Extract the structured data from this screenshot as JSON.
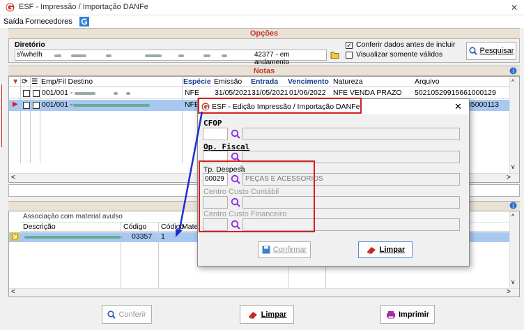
{
  "window": {
    "title": "ESF - Impressão / Importação DANFe",
    "close": "✕"
  },
  "menu": {
    "items": [
      "Saída",
      "Fornecedores"
    ]
  },
  "options": {
    "header": "Opções",
    "dir_label": "Diretório",
    "dir_value": "s\\\\whelh",
    "status_text": "42377 - em andamento",
    "check1": "Conferir dados antes de incluir",
    "check2": "Visualizar somente válidos",
    "search_button": "Pesquisar"
  },
  "notes": {
    "header": "Notas",
    "columns": [
      "Emp/Fil Destino",
      "Espécie",
      "Emissão",
      "Entrada",
      "Vencimento",
      "Natureza",
      "Arquivo"
    ],
    "rows": [
      {
        "emp": "001/001 -",
        "especie": "NFE",
        "emissao": "31/05/2021",
        "entrada": "31/05/2021",
        "vencimento": "01/06/2022",
        "natureza": "NFE VENDA PRAZO",
        "arquivo": "502105299156610001​29"
      },
      {
        "emp": "001/001 -",
        "especie": "NFE",
        "emissao": "",
        "entrada": "",
        "vencimento": "",
        "natureza": "",
        "arquivo": "268266850001​13"
      }
    ]
  },
  "assoc": {
    "caption": "Associação com material avulso",
    "columns": [
      "Descrição",
      "Código",
      "Código",
      "Materi"
    ],
    "row": {
      "codigo": "03357",
      "codigo2": "1"
    }
  },
  "bottom": {
    "conferir": "Conferir",
    "limpar": "Limpar",
    "imprimir": "Imprimir"
  },
  "dialog": {
    "title": "ESF - Edição Impressão / Importação DANFe",
    "cfop_label": "CFOP",
    "opfiscal_label": "Op. Fiscal",
    "tpdespesa_label": "Tp. Despesa",
    "tpdespesa_code": "00029",
    "tpdespesa_desc": "PEÇAS E ACESSORIOS",
    "ccc_label": "Centro Custo Contábil",
    "ccf_label": "Centro Custo Financeiro",
    "confirm_button": "Confirmar",
    "clear_button": "Limpar"
  },
  "colors": {
    "accent": "#c0392b",
    "selected_row": "#a8c8f0",
    "highlight": "#d42020"
  }
}
